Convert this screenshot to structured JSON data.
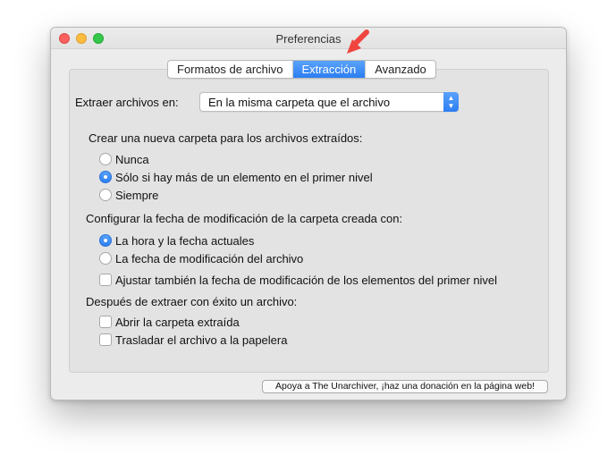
{
  "window": {
    "title": "Preferencias"
  },
  "tabs": [
    {
      "label": "Formatos de archivo"
    },
    {
      "label": "Extracción",
      "active": true
    },
    {
      "label": "Avanzado"
    }
  ],
  "extract_to": {
    "label": "Extraer archivos en:",
    "selected": "En la misma carpeta que el archivo"
  },
  "new_folder": {
    "heading": "Crear una nueva carpeta para los archivos extraídos:",
    "options": [
      {
        "label": "Nunca",
        "selected": false
      },
      {
        "label": "Sólo si hay más de un elemento en el primer nivel",
        "selected": true
      },
      {
        "label": "Siempre",
        "selected": false
      }
    ]
  },
  "mod_date": {
    "heading": "Configurar la fecha de modificación de la carpeta creada con:",
    "options": [
      {
        "label": "La hora y la fecha actuales",
        "selected": true
      },
      {
        "label": "La fecha de modificación del archivo",
        "selected": false
      }
    ],
    "checkbox": {
      "label": "Ajustar también la fecha de modificación de los elementos del primer nivel",
      "checked": false
    }
  },
  "after_extract": {
    "heading": "Después de extraer con éxito un archivo:",
    "checkboxes": [
      {
        "label": "Abrir la carpeta extraída",
        "checked": false
      },
      {
        "label": "Trasladar el archivo a la papelera",
        "checked": false
      }
    ]
  },
  "donate_button": {
    "label": "Apoya a The Unarchiver, ¡haz una donación en la página web!"
  },
  "colors": {
    "accent": "#2c7ef2",
    "annotation_arrow": "#f0453f"
  },
  "icons": {
    "annotation": "red-arrow-icon",
    "select": "chevron-updown-icon"
  }
}
